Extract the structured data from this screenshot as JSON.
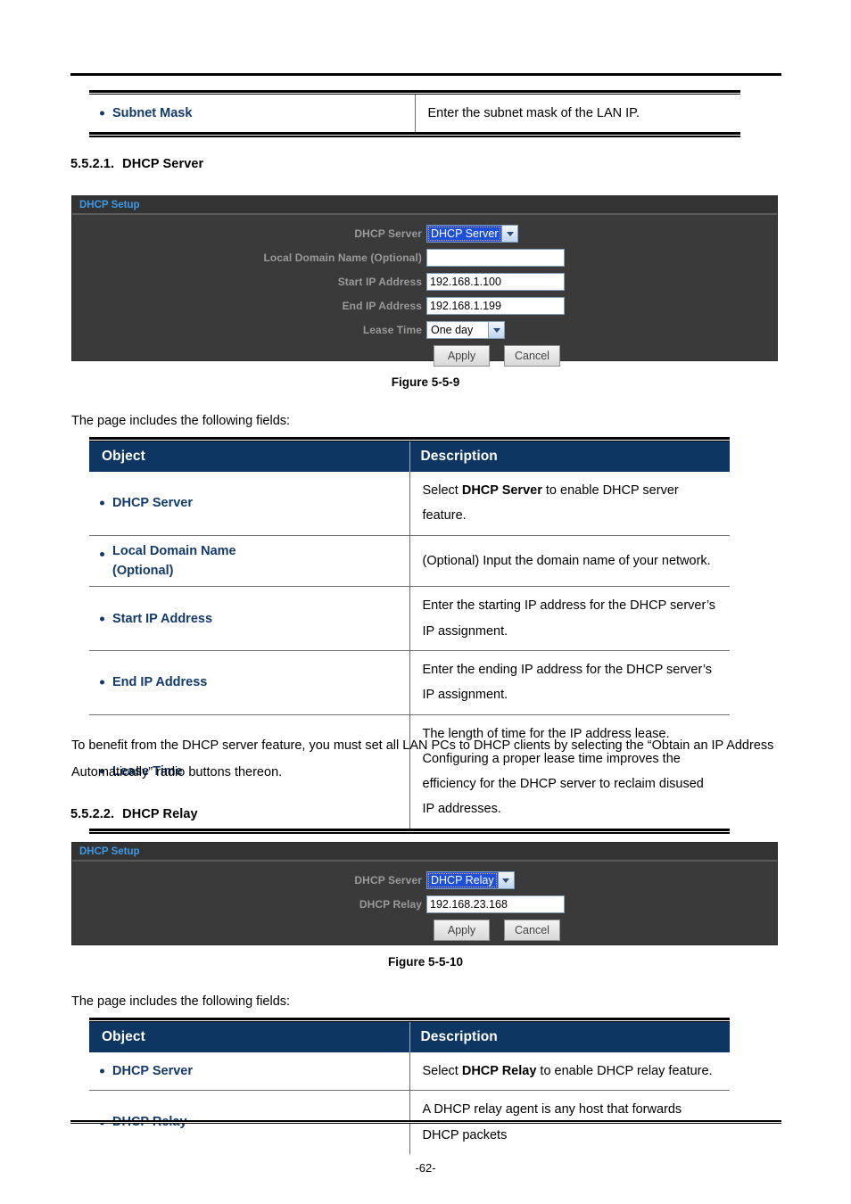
{
  "document": {
    "page_number": "-62-"
  },
  "top_table": {
    "rows": [
      {
        "object": "Subnet Mask",
        "description": "Enter the subnet mask of the LAN IP."
      }
    ]
  },
  "section_dhcp_server": {
    "number": "5.5.2.1.",
    "title": "DHCP Server",
    "figure_caption": "Figure 5-5-9",
    "intro": "The page includes the following fields:",
    "panel": {
      "title": "DHCP Setup",
      "fields": [
        {
          "label": "DHCP Server",
          "type": "select-focused",
          "value": "DHCP Server"
        },
        {
          "label": "Local Domain Name (Optional)",
          "type": "text",
          "value": ""
        },
        {
          "label": "Start IP Address",
          "type": "text",
          "value": "192.168.1.100"
        },
        {
          "label": "End IP Address",
          "type": "text",
          "value": "192.168.1.199"
        },
        {
          "label": "Lease Time",
          "type": "select",
          "value": "One day"
        }
      ],
      "buttons": {
        "apply": "Apply",
        "cancel": "Cancel"
      }
    },
    "table": {
      "headers": {
        "object": "Object",
        "description": "Description"
      },
      "rows": [
        {
          "object": "DHCP Server",
          "desc_pre": "Select ",
          "desc_bold": "DHCP Server",
          "desc_post": " to enable DHCP server feature."
        },
        {
          "object": "Local Domain Name (Optional)",
          "object_line1": "Local Domain Name",
          "object_line2": "(Optional)",
          "desc_pre": "(Optional) Input the domain name of your network.",
          "desc_bold": "",
          "desc_post": ""
        },
        {
          "object": "Start IP Address",
          "desc_pre": "Enter the starting IP address for the DHCP server’s IP assignment.",
          "desc_bold": "",
          "desc_post": ""
        },
        {
          "object": "End IP Address",
          "desc_pre": "Enter the ending IP address for the DHCP server’s IP assignment.",
          "desc_bold": "",
          "desc_post": ""
        },
        {
          "object": "Lease Time",
          "desc_pre": "The length of time for the IP address lease. Configuring a proper lease time improves the efficiency for the DHCP server to reclaim disused IP addresses.",
          "desc_bold": "",
          "desc_post": ""
        }
      ]
    },
    "note": "To benefit from the DHCP server feature, you must set all LAN PCs to DHCP clients by selecting the “Obtain an IP Address Automatically” radio buttons thereon."
  },
  "section_dhcp_relay": {
    "number": "5.5.2.2.",
    "title": "DHCP Relay",
    "figure_caption": "Figure 5-5-10",
    "intro": "The page includes the following fields:",
    "panel": {
      "title": "DHCP Setup",
      "fields": [
        {
          "label": "DHCP Server",
          "type": "select-focused",
          "value": "DHCP Relay"
        },
        {
          "label": "DHCP Relay",
          "type": "text",
          "value": "192.168.23.168"
        }
      ],
      "buttons": {
        "apply": "Apply",
        "cancel": "Cancel"
      }
    },
    "table": {
      "headers": {
        "object": "Object",
        "description": "Description"
      },
      "rows": [
        {
          "object": "DHCP Server",
          "desc_pre": "Select ",
          "desc_bold": "DHCP Relay",
          "desc_post": " to enable DHCP relay feature."
        },
        {
          "object": "DHCP Relay",
          "desc_pre": "A  DHCP  relay  agent  is  any  host  that  forwards  DHCP  packets",
          "desc_bold": "",
          "desc_post": ""
        }
      ]
    }
  },
  "colors": {
    "table_header_bg": "#0d3663",
    "object_text": "#123a6b",
    "panel_bg": "#3a3a3a",
    "panel_title_text": "#3d9ae8",
    "select_highlight": "#1e4fd8"
  }
}
